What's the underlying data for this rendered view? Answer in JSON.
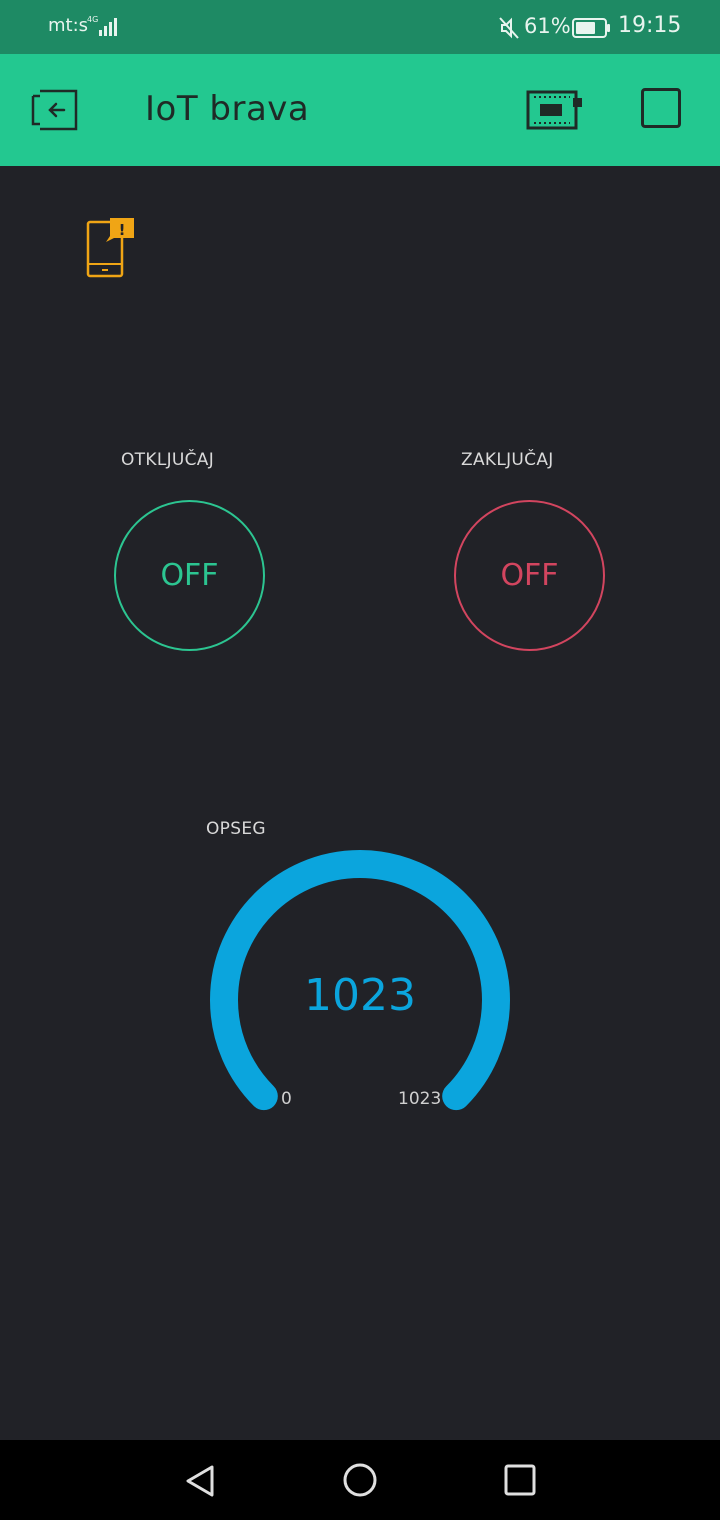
{
  "status_bar": {
    "carrier": "mt:s",
    "network": "4G",
    "battery_percent": "61%",
    "time": "19:15",
    "icons": [
      "signal-icon",
      "mute-icon",
      "battery-icon"
    ]
  },
  "app_bar": {
    "title": "IoT brava",
    "icons": [
      "back-exit-icon",
      "device-hardware-icon",
      "stop-square-icon"
    ]
  },
  "notification": {
    "icon": "phone-warning-icon",
    "badge": "!"
  },
  "buttons": [
    {
      "label": "OTKLJUČAJ",
      "state": "OFF",
      "color": "#2cc591"
    },
    {
      "label": "ZAKLJUČAJ",
      "state": "OFF",
      "color": "#d2455f"
    }
  ],
  "gauge": {
    "label": "OPSEG",
    "value": "1023",
    "min": "0",
    "max": "1023",
    "fill_fraction": 1.0,
    "color": "#0ba5dd"
  },
  "nav_bar": {
    "icons": [
      "back-triangle-icon",
      "home-circle-icon",
      "recents-square-icon"
    ]
  },
  "colors": {
    "accent": "#23c890",
    "background": "#212227"
  }
}
